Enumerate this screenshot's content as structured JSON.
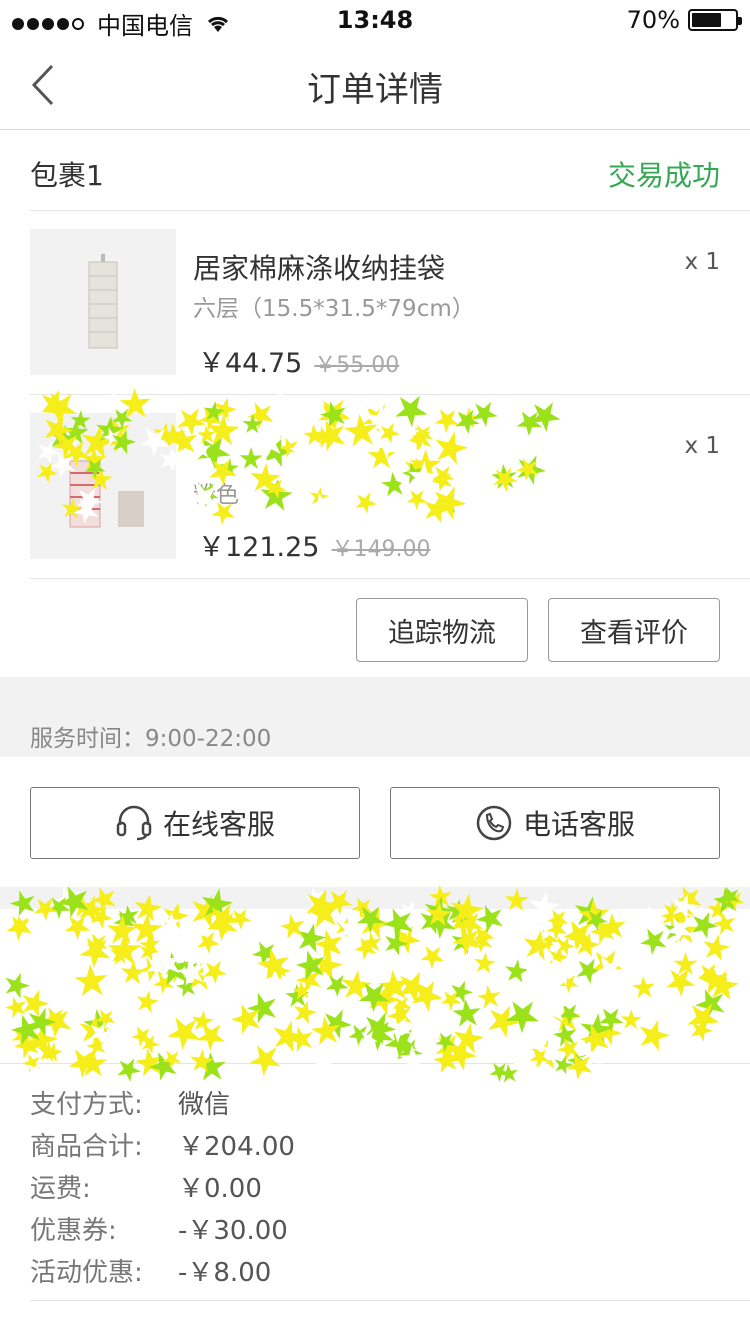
{
  "status_bar": {
    "carrier": "中国电信",
    "time": "13:48",
    "battery": "70%",
    "battery_level": 0.7
  },
  "nav": {
    "title": "订单详情",
    "back_icon": "chevron-left-icon"
  },
  "package": {
    "name": "包裹1",
    "status": "交易成功",
    "status_color": "#34a853"
  },
  "items": [
    {
      "name": "居家棉麻涤收纳挂袋",
      "spec": "六层（15.5*31.5*79cm）",
      "qty": "x 1",
      "price": "￥44.75",
      "old_price": "￥55.00"
    },
    {
      "name": "",
      "spec": "粉色",
      "qty": "x 1",
      "price": "￥121.25",
      "old_price": "￥149.00"
    }
  ],
  "actions": {
    "track": "追踪物流",
    "review": "查看评价"
  },
  "service": {
    "hours": "服务时间：9:00-22:00"
  },
  "customer_service": {
    "online": "在线客服",
    "phone": "电话客服"
  },
  "summary": {
    "rows": [
      {
        "key": "支付方式:",
        "value": "微信"
      },
      {
        "key": "商品合计:",
        "value": "￥204.00"
      },
      {
        "key": "运费:",
        "value": "￥0.00"
      },
      {
        "key": "优惠券:",
        "value": "-￥30.00"
      },
      {
        "key": "活动优惠:",
        "value": "-￥8.00"
      }
    ]
  },
  "colors": {
    "accent_green": "#34a853",
    "scribble_yellow": "#f5ee1a",
    "scribble_green": "#9be21a"
  }
}
